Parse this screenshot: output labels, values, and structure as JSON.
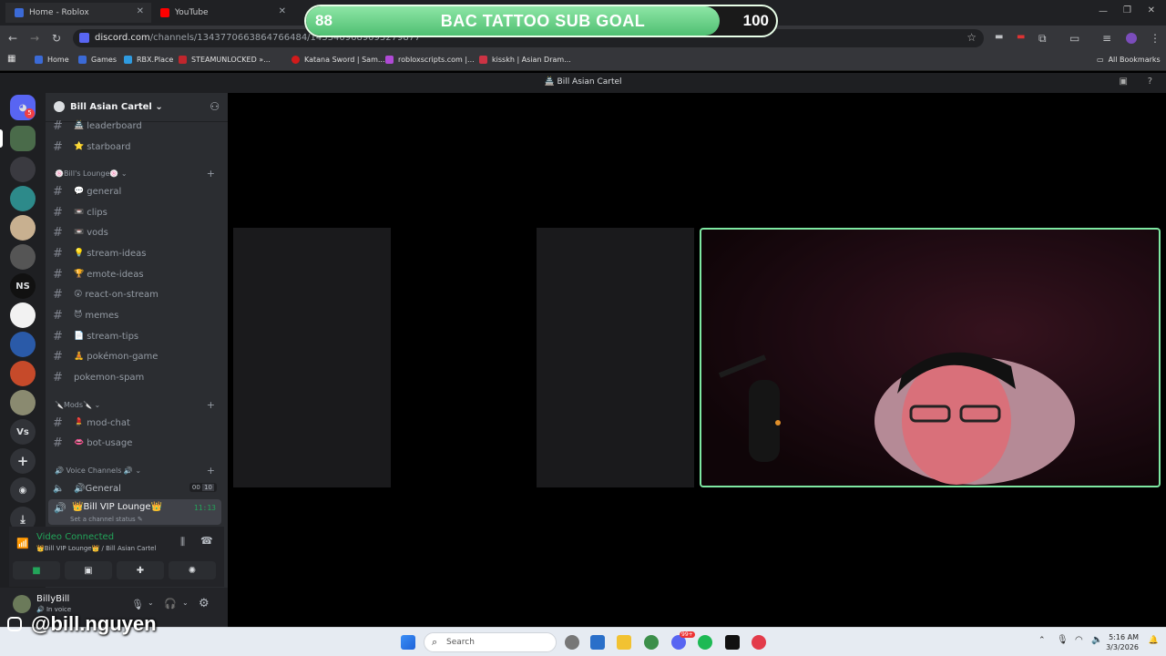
{
  "browser": {
    "tabs": [
      {
        "title": "Home - Roblox",
        "color": "#3b6ad6"
      },
      {
        "title": "YouTube",
        "color": "#ff0000"
      }
    ],
    "url_host": "discord.com",
    "url_path": "/channels/1343770663864766484/1433409689093279877",
    "bookmarks": [
      {
        "label": "Home",
        "color": "#3b6ad6"
      },
      {
        "label": "Games",
        "color": "#3b6ad6"
      },
      {
        "label": "RBX.Place",
        "color": "#2f9be0"
      },
      {
        "label": "STEAMUNLOCKED »...",
        "color": "#c0262d"
      },
      {
        "label": "Katana Sword | Sam...",
        "color": "#d21b1b"
      },
      {
        "label": "robloxscripts.com |...",
        "color": "#b04ad6"
      },
      {
        "label": "kisskh | Asian Dram...",
        "color": "#cc3344"
      }
    ],
    "all_bookmarks": "All Bookmarks"
  },
  "overlay": {
    "current": "88",
    "title": "BAC TATTOO SUB GOAL",
    "target": "100",
    "progress": 0.88,
    "handle": "@bill.nguyen"
  },
  "discord": {
    "title": "Bill Asian Cartel",
    "server_badge": "5",
    "server_labels": [
      "NS",
      "Vs"
    ],
    "guild_name": "Bill Asian Cartel",
    "top_channels": [
      {
        "emoji": "🏯",
        "name": "leaderboard"
      },
      {
        "emoji": "⭐",
        "name": "starboard"
      }
    ],
    "lounge_category": "Bill's Lounge",
    "lounge_emoji": "🍥",
    "lounge_channels": [
      {
        "emoji": "💬",
        "name": "general"
      },
      {
        "emoji": "📼",
        "name": "clips"
      },
      {
        "emoji": "📼",
        "name": "vods"
      },
      {
        "emoji": "💡",
        "name": "stream-ideas"
      },
      {
        "emoji": "🏆",
        "name": "emote-ideas"
      },
      {
        "emoji": "😲",
        "name": "react-on-stream"
      },
      {
        "emoji": "😈",
        "name": "memes"
      },
      {
        "emoji": "📄",
        "name": "stream-tips"
      },
      {
        "emoji": "🧘",
        "name": "pokémon-game"
      },
      {
        "emoji": "",
        "name": "pokemon-spam"
      }
    ],
    "mods_category": "Mods",
    "mods_emoji": "🔪",
    "mods_channels": [
      {
        "emoji": "💄",
        "name": "mod-chat"
      },
      {
        "emoji": "👄",
        "name": "bot-usage"
      }
    ],
    "voice_category": "Voice Channels",
    "voice_emoji": "🔊",
    "voice_general": {
      "name": "General",
      "emoji": "🔊",
      "count_a": "00",
      "count_b": "10"
    },
    "voice_vip": {
      "name": "Bill VIP Lounge",
      "emoji": "👑",
      "timer": "11:13",
      "status": "Set a channel status"
    },
    "voice_panel": {
      "status": "Video Connected",
      "location": "Bill VIP Lounge",
      "location_server": "/ Bill Asian Cartel"
    },
    "user": {
      "name": "BillyBill",
      "status": "In voice"
    }
  },
  "taskbar": {
    "search": "Search",
    "time": "5:16 AM",
    "date": "3/3/2026",
    "notif_count": "99+"
  }
}
